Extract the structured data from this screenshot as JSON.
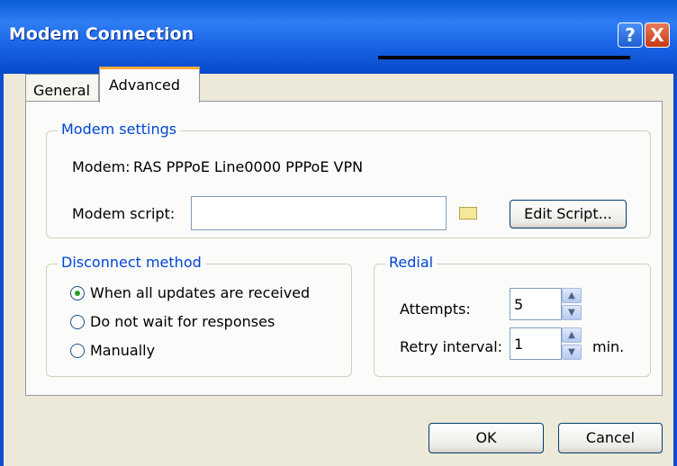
{
  "window": {
    "title": "Modem Connection",
    "help_label": "?",
    "close_label": "X"
  },
  "tabs": [
    {
      "label": "General",
      "active": false
    },
    {
      "label": "Advanced",
      "active": true
    }
  ],
  "modem_settings": {
    "legend": "Modem settings",
    "modem_label": "Modem:",
    "modem_value": "RAS PPPoE Line0000 PPPoE VPN",
    "script_label": "Modem script:",
    "script_value": "",
    "edit_script_label": "Edit Script...",
    "browse_icon": "folder-icon"
  },
  "disconnect_method": {
    "legend": "Disconnect method",
    "options": [
      {
        "label": "When all updates are received",
        "checked": true
      },
      {
        "label": "Do not wait for responses",
        "checked": false
      },
      {
        "label": "Manually",
        "checked": false
      }
    ]
  },
  "redial": {
    "legend": "Redial",
    "attempts_label": "Attempts:",
    "attempts_value": "5",
    "retry_label": "Retry interval:",
    "retry_value": "1",
    "retry_unit": "min."
  },
  "footer": {
    "ok_label": "OK",
    "cancel_label": "Cancel"
  },
  "colors": {
    "title_bar": "#1a64e6",
    "dialog_bg": "#ece9d8",
    "legend_text": "#0046d5",
    "tab_highlight": "#f3a73b"
  }
}
